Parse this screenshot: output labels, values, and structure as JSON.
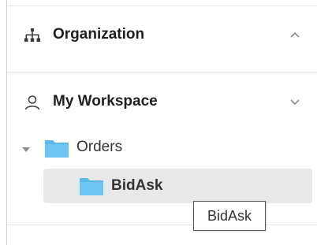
{
  "sections": {
    "organization": {
      "label": "Organization",
      "icon": "sitemap-icon",
      "chevron": "chevron-up-icon"
    },
    "workspace": {
      "label": "My Workspace",
      "icon": "user-icon",
      "chevron": "chevron-down-icon"
    }
  },
  "tree": {
    "folder": {
      "label": "Orders",
      "icon": "folder-icon",
      "expander": "caret-down-icon"
    },
    "child": {
      "label": "BidAsk",
      "icon": "folder-icon",
      "selected": true
    }
  },
  "tooltip": {
    "text": "BidAsk"
  },
  "colors": {
    "folder": "#5ab9ea",
    "selected_bg": "#e8e8e8",
    "divider": "#e4e4e4",
    "icon": "#3a3a3a",
    "chevron": "#8a8a8a"
  }
}
